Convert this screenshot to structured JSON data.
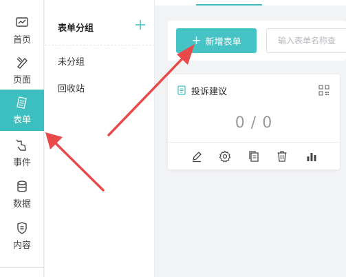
{
  "sidebar": {
    "items": [
      {
        "label": "首页",
        "icon": "dashboard-icon",
        "active": false
      },
      {
        "label": "页面",
        "icon": "pages-icon",
        "active": false
      },
      {
        "label": "表单",
        "icon": "form-icon",
        "active": true
      },
      {
        "label": "事件",
        "icon": "event-icon",
        "active": false
      },
      {
        "label": "数据",
        "icon": "database-icon",
        "active": false
      },
      {
        "label": "内容",
        "icon": "content-icon",
        "active": false
      }
    ]
  },
  "groups": {
    "title": "表单分组",
    "items": [
      "未分组",
      "回收站"
    ]
  },
  "toolbar": {
    "new_label": "新增表单",
    "search_placeholder": "输入表单名称查"
  },
  "form_card": {
    "title": "投诉建议",
    "count": "0 / 0"
  },
  "colors": {
    "accent": "#3dbfc0",
    "annotation": "#e84a4a"
  }
}
